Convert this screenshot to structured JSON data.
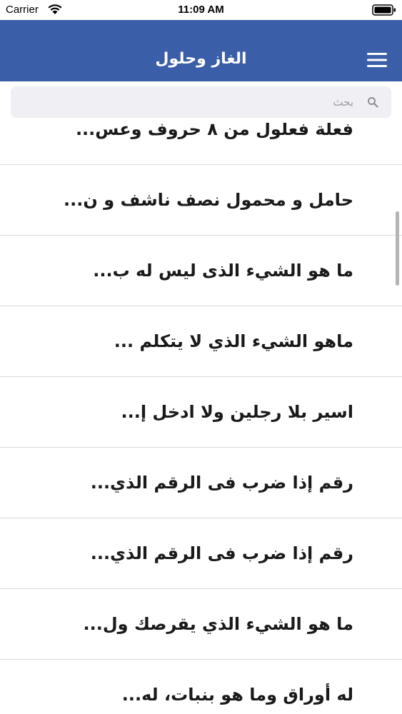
{
  "status_bar": {
    "carrier": "Carrier",
    "time": "11:09 AM",
    "icons": [
      "wifi-icon",
      "battery-icon"
    ]
  },
  "nav": {
    "title": "الغاز وحلول",
    "menu_icon": "hamburger-menu-icon",
    "background_color": "#3b5ea8"
  },
  "search": {
    "placeholder": "بحث",
    "value": "",
    "icon": "search-icon"
  },
  "list": {
    "items": [
      {
        "label": "فعلة فعلول من ٨ حروف وعس..."
      },
      {
        "label": "حامل و محمول نصف ناشف و ن..."
      },
      {
        "label": "ما هو الشيء الذى ليس له ب..."
      },
      {
        "label": "ماهو الشيء الذي لا يتكلم ..."
      },
      {
        "label": "اسير بلا رجلين ولا ادخل إ..."
      },
      {
        "label": "رقم إذا ضرب فى الرقم الذي..."
      },
      {
        "label": "رقم إذا ضرب فى الرقم الذي..."
      },
      {
        "label": "ما هو الشيء الذي يقرصك ول..."
      },
      {
        "label": "له أوراق وما هو بنبات، له..."
      }
    ]
  }
}
